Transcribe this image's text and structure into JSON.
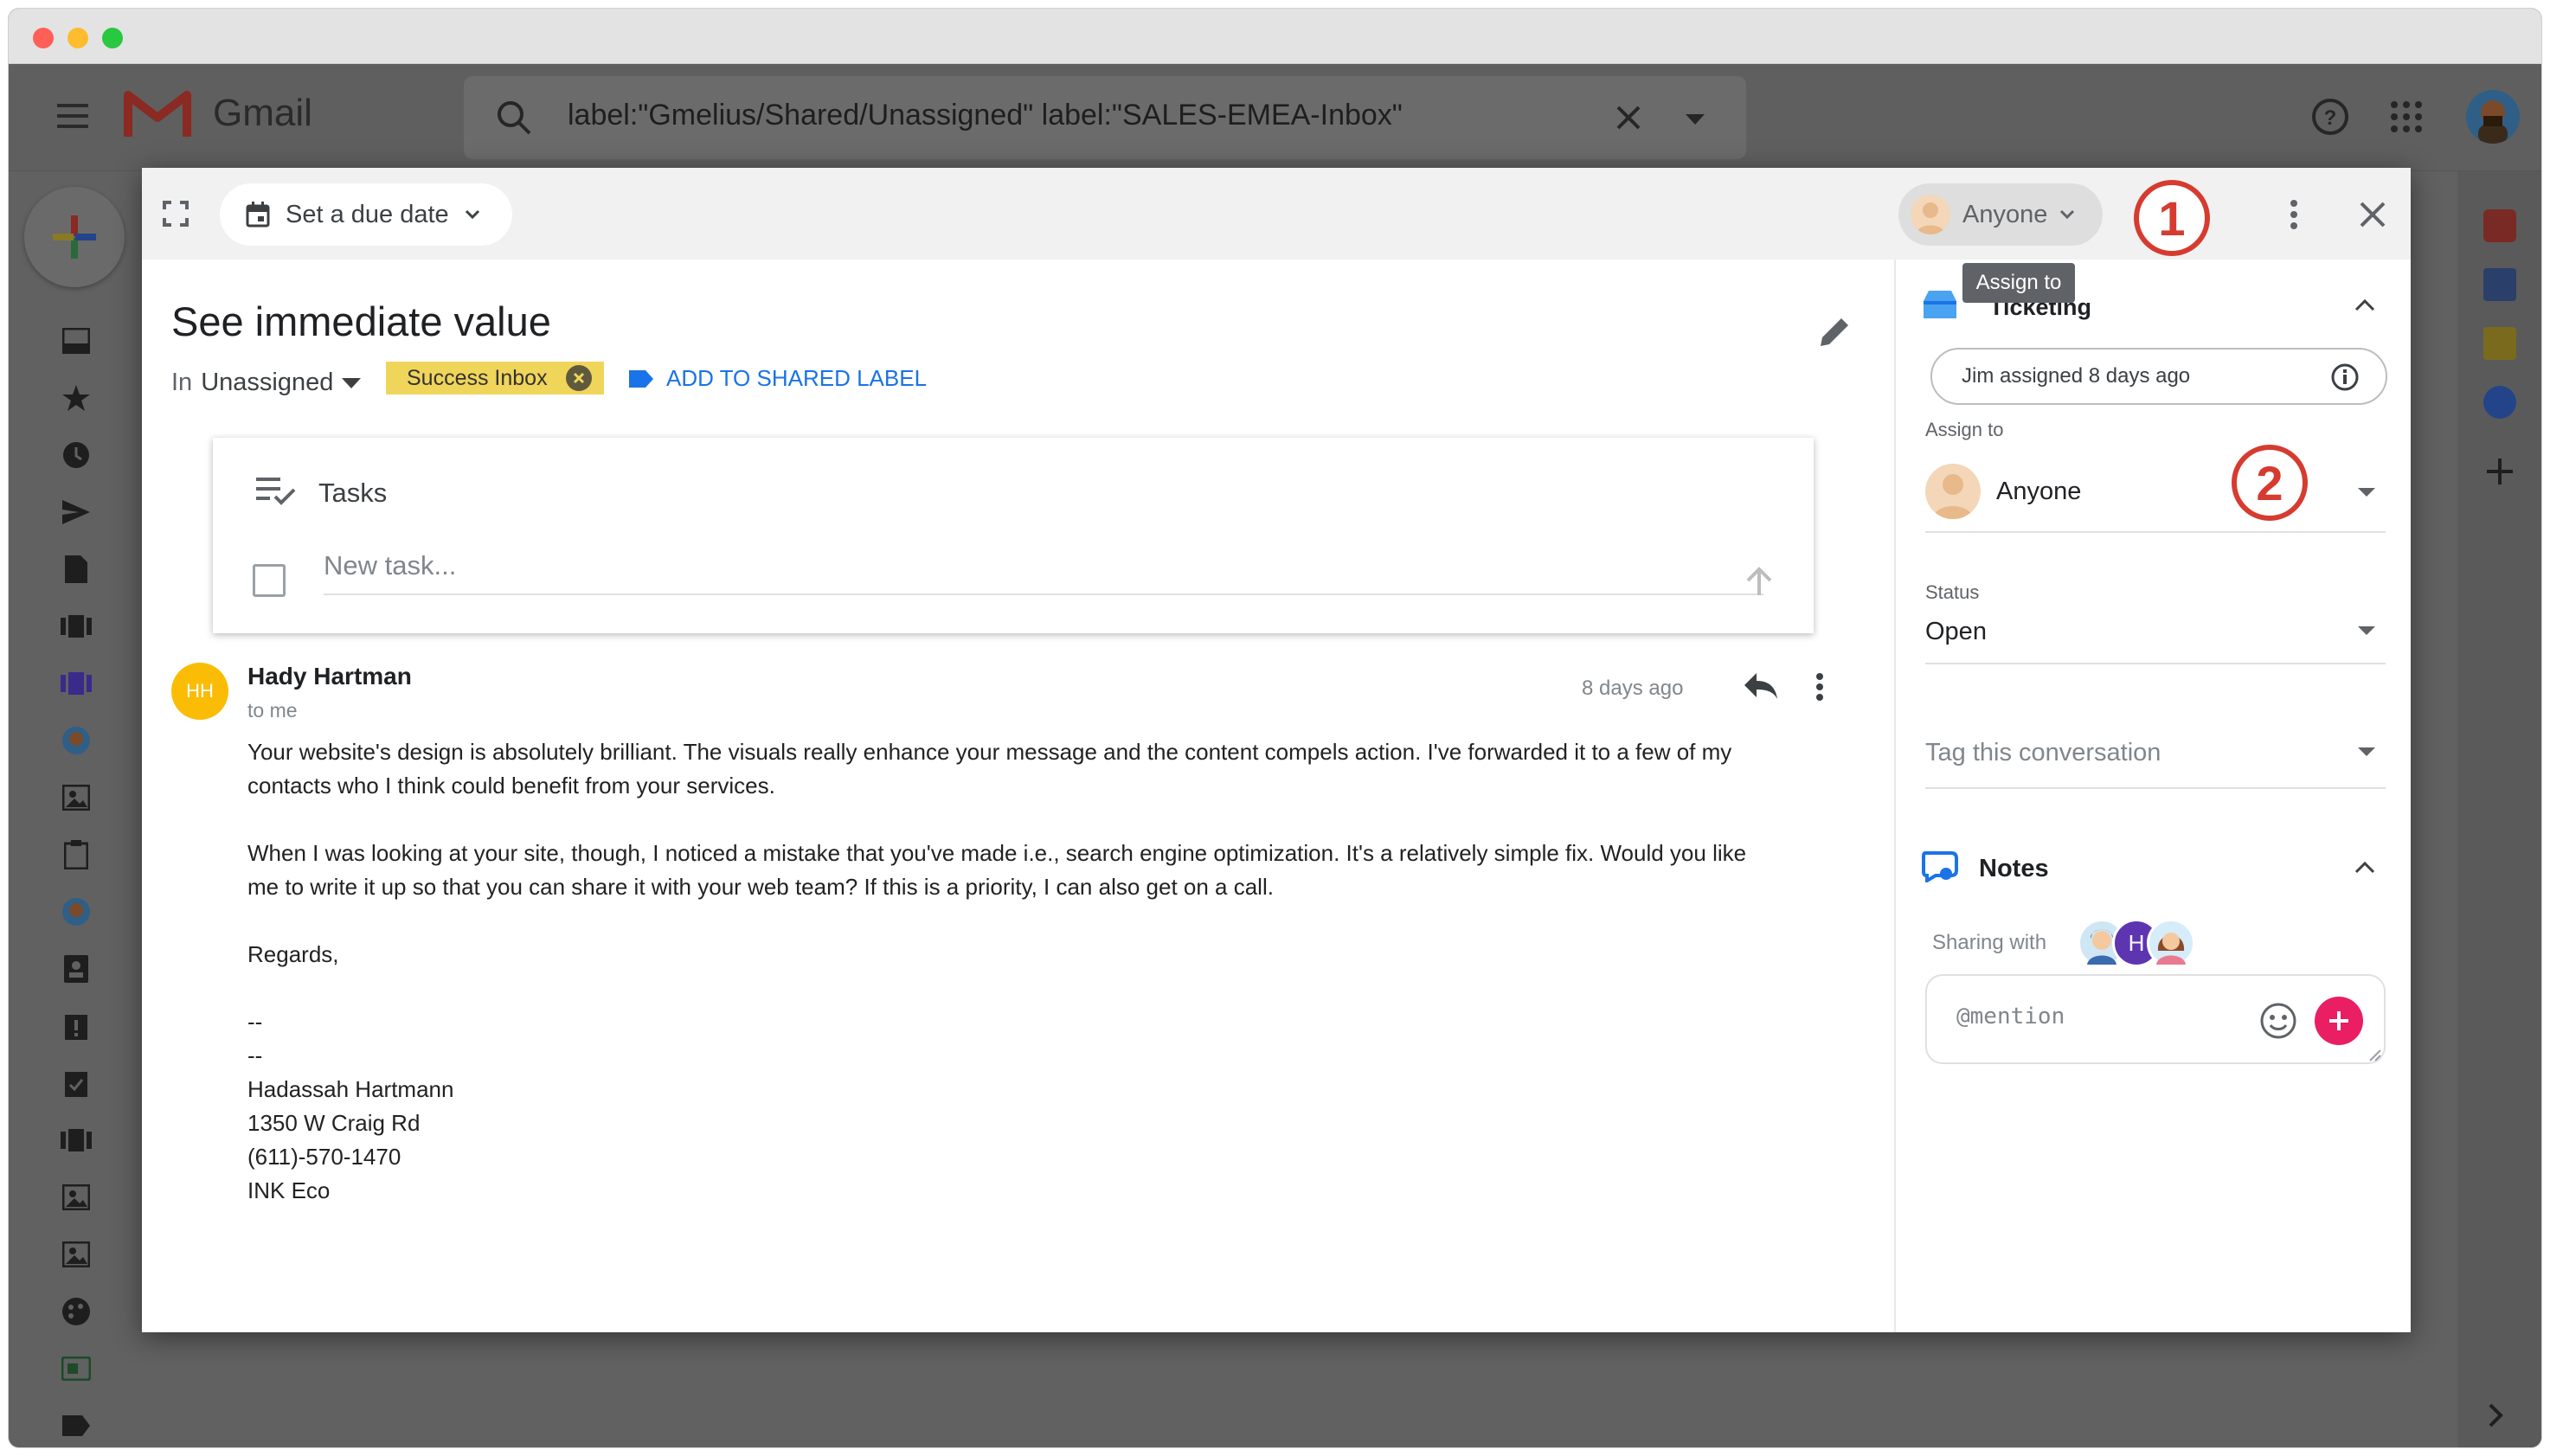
{
  "window": {
    "traffic_lights": {
      "close": "#ff5f57",
      "minimize": "#febc2e",
      "zoom": "#28c840"
    }
  },
  "gmail": {
    "brand": "Gmail",
    "search_query": "label:\"Gmelius/Shared/Unassigned\" label:\"SALES-EMEA-Inbox\""
  },
  "modal": {
    "due_date_label": "Set a due date",
    "assign_chip_label": "Anyone",
    "tooltip": "Assign to",
    "callout_1": "1",
    "callout_2": "2",
    "subject": "See immediate value",
    "in_prefix": "In",
    "in_value": "Unassigned",
    "label_chip": "Success Inbox",
    "add_shared_label": "ADD TO SHARED LABEL",
    "tasks": {
      "title": "Tasks",
      "new_task_placeholder": "New task..."
    },
    "message": {
      "avatar_initials": "HH",
      "sender": "Hady Hartman",
      "recipient": "to me",
      "time": "8 days ago",
      "body": [
        "Your website's design is absolutely brilliant. The visuals really enhance your message and the content compels action. I've forwarded it to a few of my",
        "contacts who I think could benefit from your services.",
        "When I was looking at your site, though, I noticed a mistake that you've made i.e., search engine optimization. It's a relatively simple fix. Would you like",
        "me to write it up so that you can share it with your web team? If this is a priority, I can also get on a call.",
        "Regards,",
        "--",
        "--",
        "Hadassah Hartmann",
        "1350 W Craig Rd",
        "(611)-570-1470",
        "INK Eco"
      ]
    }
  },
  "sidebar": {
    "ticketing_title": "Ticketing",
    "activity": "Jim assigned 8 days ago",
    "assign_label": "Assign to",
    "assign_value": "Anyone",
    "status_label": "Status",
    "status_value": "Open",
    "tag_placeholder": "Tag this conversation",
    "notes_title": "Notes",
    "sharing_with": "Sharing with",
    "sharing_avatar_initial": "H",
    "mention_placeholder": "@mention"
  },
  "colors": {
    "accent_blue": "#1a73e8",
    "label_yellow": "#f0d55b",
    "add_pink": "#e91e63",
    "callout_red": "#d63b30",
    "avatar_yellow": "#fbbc05"
  }
}
